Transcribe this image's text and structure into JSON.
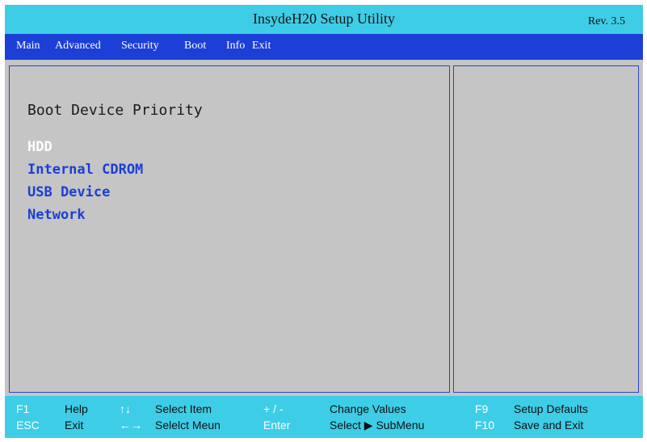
{
  "window": {
    "title": "InsydeH20 Setup Utility",
    "revision": "Rev. 3.5"
  },
  "menu": {
    "items": [
      {
        "label": "Main"
      },
      {
        "label": "Advanced"
      },
      {
        "label": "Security"
      },
      {
        "label": "Boot"
      },
      {
        "label": "Info"
      },
      {
        "label": "Exit"
      }
    ]
  },
  "boot_page": {
    "heading": "Boot Device Priority",
    "devices": [
      {
        "label": "HDD",
        "selected": true
      },
      {
        "label": "Internal CDROM",
        "selected": false
      },
      {
        "label": "USB Device",
        "selected": false
      },
      {
        "label": "Network",
        "selected": false
      }
    ]
  },
  "footer": {
    "row1": [
      {
        "key": "F1",
        "desc": "Help"
      },
      {
        "key": "↑↓",
        "desc": "Select Item"
      },
      {
        "key": "+ / -",
        "desc": "Change Values"
      },
      {
        "key": "F9",
        "desc": "Setup Defaults"
      }
    ],
    "row2": [
      {
        "key": "ESC",
        "desc": "Exit"
      },
      {
        "key": "←→",
        "desc": "Selelct Meun"
      },
      {
        "key": "Enter",
        "desc": "Select ▶ SubMenu"
      },
      {
        "key": "F10",
        "desc": "Save and Exit"
      }
    ]
  },
  "colors": {
    "title_bar": "#3ecde6",
    "menu_bar": "#1c3fd8",
    "panel_bg": "#c5c5c5",
    "item_text": "#1a3fd6",
    "selected_text": "#ffffff"
  }
}
